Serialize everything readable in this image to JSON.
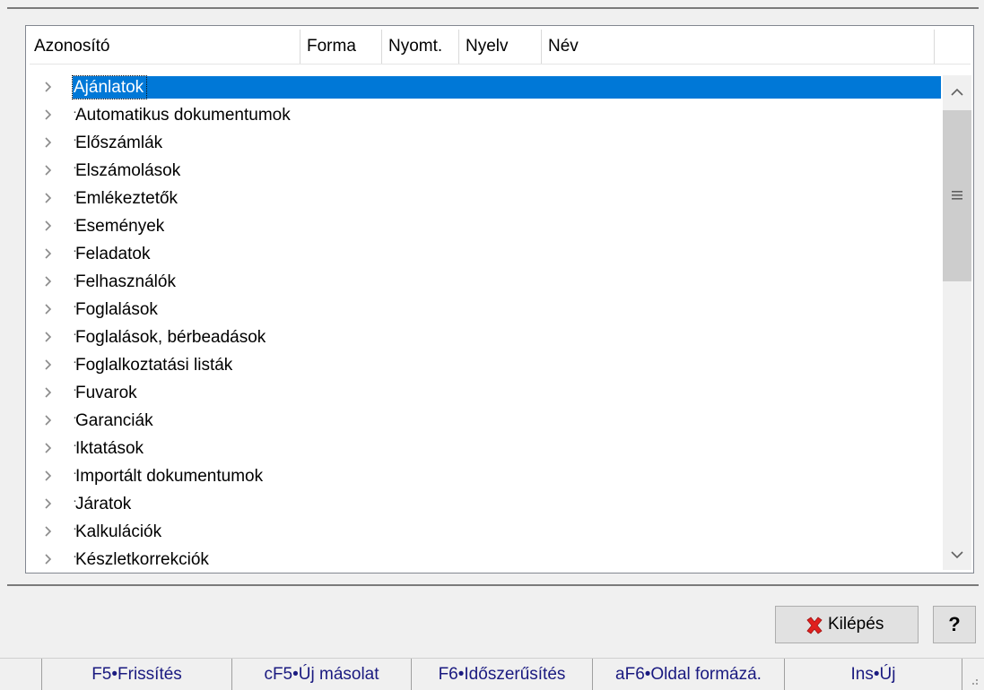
{
  "columns": [
    "Azonosító",
    "Forma",
    "Nyomt.",
    "Nyelv",
    "Név"
  ],
  "tree_items": [
    "Ajánlatok",
    "Automatikus dokumentumok",
    "Előszámlák",
    "Elszámolások",
    "Emlékeztetők",
    "Események",
    "Feladatok",
    "Felhasználók",
    "Foglalások",
    "Foglalások, bérbeadások",
    "Foglalkoztatási listák",
    "Fuvarok",
    "Garanciák",
    "Iktatások",
    "Importált dokumentumok",
    "Járatok",
    "Kalkulációk",
    "Készletkorrekciók"
  ],
  "selected_index": 0,
  "buttons": {
    "exit": "Kilépés",
    "help": "?"
  },
  "statusbar": [
    "F5•Frissítés",
    "cF5•Új másolat",
    "F6•Időszerűsítés",
    "aF6•Oldal formázá.",
    "Ins•Új"
  ],
  "colors": {
    "selection": "#0078d7",
    "status_text": "#1a1a80",
    "exit_icon": "#e0201e"
  }
}
